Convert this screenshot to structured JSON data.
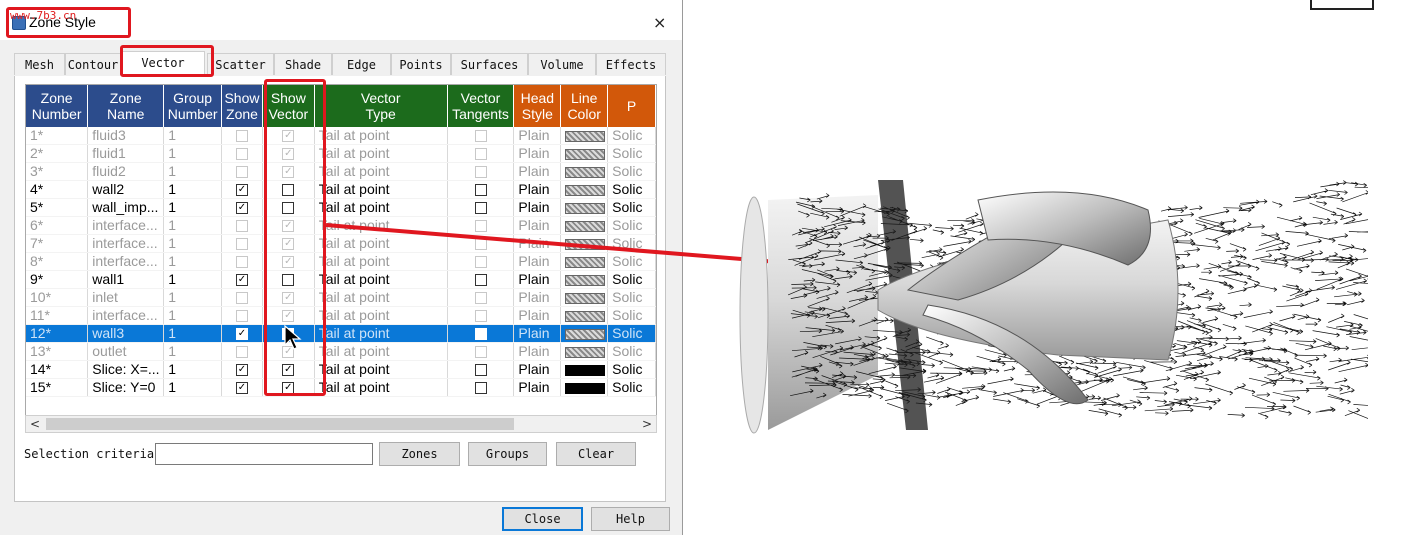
{
  "dialog": {
    "title": "Zone Style",
    "watermark": "www.7b3.cn",
    "close_glyph": "×",
    "tabs": [
      {
        "label": "Mesh"
      },
      {
        "label": "Contour"
      },
      {
        "label": "Vector"
      },
      {
        "label": "Scatter"
      },
      {
        "label": "Shade"
      },
      {
        "label": "Edge"
      },
      {
        "label": "Points"
      },
      {
        "label": "Surfaces"
      },
      {
        "label": "Volume"
      },
      {
        "label": "Effects"
      }
    ],
    "active_tab": "Vector"
  },
  "grid": {
    "headers": [
      {
        "line1": "Zone",
        "line2": "Number"
      },
      {
        "line1": "Zone",
        "line2": "Name"
      },
      {
        "line1": "Group",
        "line2": "Number"
      },
      {
        "line1": "Show",
        "line2": "Zone"
      },
      {
        "line1": "Show",
        "line2": "Vector"
      },
      {
        "line1": "Vector",
        "line2": "Type"
      },
      {
        "line1": "Vector",
        "line2": "Tangents"
      },
      {
        "line1": "Head",
        "line2": "Style"
      },
      {
        "line1": "Line",
        "line2": "Color"
      },
      {
        "line1": "P",
        "line2": ""
      }
    ],
    "rows": [
      {
        "num": "1*",
        "name": "fluid3",
        "group": "1",
        "show_zone": false,
        "show_vector": true,
        "type": "Tail at point",
        "tangents": false,
        "head": "Plain",
        "color": "hatched",
        "pattern": "Solic",
        "active": false,
        "selected": false
      },
      {
        "num": "2*",
        "name": "fluid1",
        "group": "1",
        "show_zone": false,
        "show_vector": true,
        "type": "Tail at point",
        "tangents": false,
        "head": "Plain",
        "color": "hatched",
        "pattern": "Solic",
        "active": false,
        "selected": false
      },
      {
        "num": "3*",
        "name": "fluid2",
        "group": "1",
        "show_zone": false,
        "show_vector": true,
        "type": "Tail at point",
        "tangents": false,
        "head": "Plain",
        "color": "hatched",
        "pattern": "Solic",
        "active": false,
        "selected": false
      },
      {
        "num": "4*",
        "name": "wall2",
        "group": "1",
        "show_zone": true,
        "show_vector": false,
        "type": "Tail at point",
        "tangents": false,
        "head": "Plain",
        "color": "hatched",
        "pattern": "Solic",
        "active": true,
        "selected": false
      },
      {
        "num": "5*",
        "name": "wall_imp...",
        "group": "1",
        "show_zone": true,
        "show_vector": false,
        "type": "Tail at point",
        "tangents": false,
        "head": "Plain",
        "color": "hatched",
        "pattern": "Solic",
        "active": true,
        "selected": false
      },
      {
        "num": "6*",
        "name": "interface...",
        "group": "1",
        "show_zone": false,
        "show_vector": true,
        "type": "Tail at point",
        "tangents": false,
        "head": "Plain",
        "color": "hatched",
        "pattern": "Solic",
        "active": false,
        "selected": false
      },
      {
        "num": "7*",
        "name": "interface...",
        "group": "1",
        "show_zone": false,
        "show_vector": true,
        "type": "Tail at point",
        "tangents": false,
        "head": "Plain",
        "color": "hatched",
        "pattern": "Solic",
        "active": false,
        "selected": false
      },
      {
        "num": "8*",
        "name": "interface...",
        "group": "1",
        "show_zone": false,
        "show_vector": true,
        "type": "Tail at point",
        "tangents": false,
        "head": "Plain",
        "color": "hatched",
        "pattern": "Solic",
        "active": false,
        "selected": false
      },
      {
        "num": "9*",
        "name": "wall1",
        "group": "1",
        "show_zone": true,
        "show_vector": false,
        "type": "Tail at point",
        "tangents": false,
        "head": "Plain",
        "color": "hatched",
        "pattern": "Solic",
        "active": true,
        "selected": false
      },
      {
        "num": "10*",
        "name": "inlet",
        "group": "1",
        "show_zone": false,
        "show_vector": true,
        "type": "Tail at point",
        "tangents": false,
        "head": "Plain",
        "color": "hatched",
        "pattern": "Solic",
        "active": false,
        "selected": false
      },
      {
        "num": "11*",
        "name": "interface...",
        "group": "1",
        "show_zone": false,
        "show_vector": true,
        "type": "Tail at point",
        "tangents": false,
        "head": "Plain",
        "color": "hatched",
        "pattern": "Solic",
        "active": false,
        "selected": false
      },
      {
        "num": "12*",
        "name": "wall3",
        "group": "1",
        "show_zone": true,
        "show_vector": false,
        "type": "Tail at point",
        "tangents": false,
        "head": "Plain",
        "color": "hatched",
        "pattern": "Solic",
        "active": true,
        "selected": true
      },
      {
        "num": "13*",
        "name": "outlet",
        "group": "1",
        "show_zone": false,
        "show_vector": true,
        "type": "Tail at point",
        "tangents": false,
        "head": "Plain",
        "color": "hatched",
        "pattern": "Solic",
        "active": false,
        "selected": false
      },
      {
        "num": "14*",
        "name": "Slice: X=...",
        "group": "1",
        "show_zone": true,
        "show_vector": true,
        "type": "Tail at point",
        "tangents": false,
        "head": "Plain",
        "color": "solid",
        "pattern": "Solic",
        "active": true,
        "selected": false
      },
      {
        "num": "15*",
        "name": "Slice: Y=0",
        "group": "1",
        "show_zone": true,
        "show_vector": true,
        "type": "Tail at point",
        "tangents": false,
        "head": "Plain",
        "color": "solid",
        "pattern": "Solic",
        "active": true,
        "selected": false
      }
    ]
  },
  "footer": {
    "selection_label": "Selection criteria:",
    "selection_value": "",
    "zones_label": "Zones",
    "groups_label": "Groups",
    "clear_label": "Clear",
    "close_label": "Close",
    "help_label": "Help",
    "scroll_left": "<",
    "scroll_right": ">"
  },
  "colors": {
    "header_blue": "#2c4c8c",
    "header_green": "#1c6b1c",
    "header_orange": "#d2580a",
    "selection_blue": "#0a78d7",
    "annotation_red": "#e0171f"
  }
}
